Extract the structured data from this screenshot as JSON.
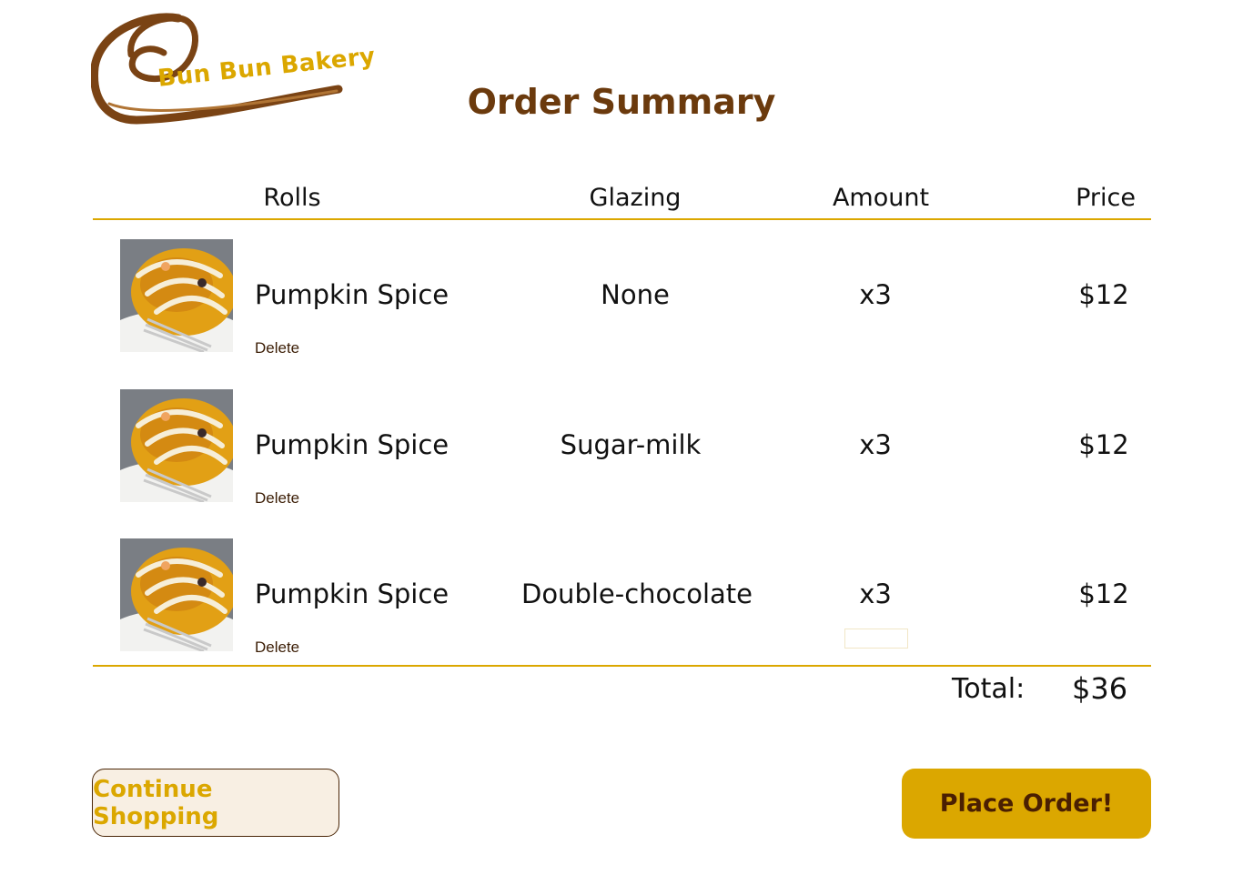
{
  "brand": {
    "name": "Bun Bun Bakery",
    "accent_color": "#dba700",
    "swirl_color": "#7a4314"
  },
  "page": {
    "title": "Order Summary"
  },
  "table": {
    "headers": {
      "rolls": "Rolls",
      "glazing": "Glazing",
      "amount": "Amount",
      "price": "Price"
    },
    "rows": [
      {
        "image": "pumpkin-spice-roll-photo",
        "name": "Pumpkin Spice",
        "glazing": "None",
        "amount": "x3",
        "price": "$12",
        "delete_label": "Delete"
      },
      {
        "image": "pumpkin-spice-roll-photo",
        "name": "Pumpkin Spice",
        "glazing": "Sugar-milk",
        "amount": "x3",
        "price": "$12",
        "delete_label": "Delete"
      },
      {
        "image": "pumpkin-spice-roll-photo",
        "name": "Pumpkin Spice",
        "glazing": "Double-chocolate",
        "amount": "x3",
        "price": "$12",
        "delete_label": "Delete"
      }
    ]
  },
  "summary": {
    "total_label": "Total:",
    "total_value": "$36"
  },
  "actions": {
    "continue_label": "Continue Shopping",
    "place_order_label": "Place Order!"
  }
}
